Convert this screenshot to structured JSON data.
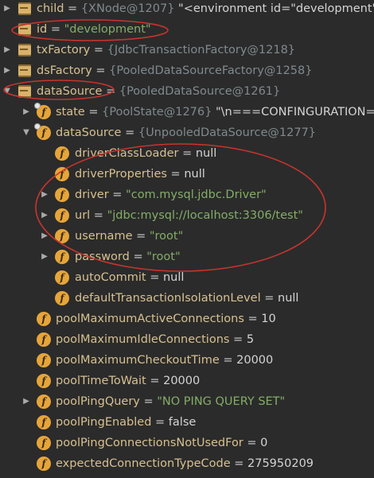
{
  "rows": [
    {
      "arrow": "▶",
      "icon": "list",
      "name": "child",
      "eq": " = ",
      "ref": "{XNode@1207}",
      "str": " \"<environment id=\"development\""
    },
    {
      "arrow": "",
      "icon": "list",
      "name": "id",
      "eq": " = ",
      "val": "\"development\"",
      "valtype": "str"
    },
    {
      "arrow": "▶",
      "icon": "list",
      "name": "txFactory",
      "eq": " = ",
      "ref": "{JdbcTransactionFactory@1218}"
    },
    {
      "arrow": "▶",
      "icon": "list",
      "name": "dsFactory",
      "eq": " = ",
      "ref": "{PooledDataSourceFactory@1258}"
    },
    {
      "arrow": "▼",
      "icon": "list",
      "name": "dataSource",
      "eq": " = ",
      "ref": "{PooledDataSource@1261}"
    },
    {
      "arrow": "▶",
      "icon": "fp",
      "name": "state",
      "eq": " = ",
      "ref": "{PoolState@1276}",
      "str": " \"\\n===CONFINGURATION==="
    },
    {
      "arrow": "▼",
      "icon": "fp",
      "name": "dataSource",
      "eq": " = ",
      "ref": "{UnpooledDataSource@1277}"
    },
    {
      "arrow": "",
      "icon": "f",
      "name": "driverClassLoader",
      "eq": " = ",
      "val": "null",
      "valtype": "kw"
    },
    {
      "arrow": "",
      "icon": "f",
      "name": "driverProperties",
      "eq": " = ",
      "val": "null",
      "valtype": "kw"
    },
    {
      "arrow": "▶",
      "icon": "f",
      "name": "driver",
      "eq": " = ",
      "val": "\"com.mysql.jdbc.Driver\"",
      "valtype": "str"
    },
    {
      "arrow": "▶",
      "icon": "f",
      "name": "url",
      "eq": " = ",
      "val": "\"jdbc:mysql://localhost:3306/test\"",
      "valtype": "str"
    },
    {
      "arrow": "▶",
      "icon": "f",
      "name": "username",
      "eq": " = ",
      "val": "\"root\"",
      "valtype": "str"
    },
    {
      "arrow": "▶",
      "icon": "f",
      "name": "password",
      "eq": " = ",
      "val": "\"root\"",
      "valtype": "str"
    },
    {
      "arrow": "",
      "icon": "f",
      "name": "autoCommit",
      "eq": " = ",
      "val": "null",
      "valtype": "kw"
    },
    {
      "arrow": "",
      "icon": "f",
      "name": "defaultTransactionIsolationLevel",
      "eq": " = ",
      "val": "null",
      "valtype": "kw"
    },
    {
      "arrow": "",
      "icon": "f",
      "name": "poolMaximumActiveConnections",
      "eq": " = ",
      "val": "10",
      "valtype": "num"
    },
    {
      "arrow": "",
      "icon": "f",
      "name": "poolMaximumIdleConnections",
      "eq": " = ",
      "val": "5",
      "valtype": "num"
    },
    {
      "arrow": "",
      "icon": "f",
      "name": "poolMaximumCheckoutTime",
      "eq": " = ",
      "val": "20000",
      "valtype": "num"
    },
    {
      "arrow": "",
      "icon": "f",
      "name": "poolTimeToWait",
      "eq": " = ",
      "val": "20000",
      "valtype": "num"
    },
    {
      "arrow": "▶",
      "icon": "f",
      "name": "poolPingQuery",
      "eq": " = ",
      "val": "\"NO PING QUERY SET\"",
      "valtype": "str"
    },
    {
      "arrow": "",
      "icon": "f",
      "name": "poolPingEnabled",
      "eq": " = ",
      "val": "false",
      "valtype": "kw"
    },
    {
      "arrow": "",
      "icon": "f",
      "name": "poolPingConnectionsNotUsedFor",
      "eq": " = ",
      "val": "0",
      "valtype": "num"
    },
    {
      "arrow": "",
      "icon": "f",
      "name": "expectedConnectionTypeCode",
      "eq": " = ",
      "val": "275950209",
      "valtype": "num"
    }
  ]
}
